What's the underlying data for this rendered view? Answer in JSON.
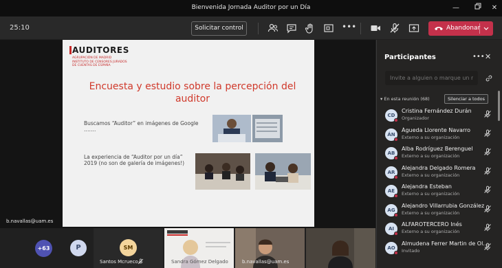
{
  "window": {
    "title": "Bienvenida Jornada Auditor por un Día"
  },
  "toolbar": {
    "timer": "25:10",
    "control_label": "Solicitar control",
    "leave_label": "Abandonar",
    "icons": [
      "participants-icon",
      "chat-icon",
      "raise-hand-icon",
      "share-tray-icon",
      "more-icon",
      "camera-icon",
      "mic-off-icon",
      "share-screen-icon"
    ],
    "leave_color": "#c4314b"
  },
  "slide": {
    "logo": "AUDITORES",
    "logo_sub": [
      "AGRUPACIÓN DE MADRID",
      "INSTITUTO DE CENSORES JURADOS",
      "DE CUENTAS DE ESPAÑA"
    ],
    "title": "Encuesta y estudio sobre la percepción del auditor",
    "line1": "Buscamos “Auditor” en imágenes de Google …….",
    "line2a": "La experiencia de “Auditor por un día”",
    "line2b": "2019  (no son de galería de imágenes!)"
  },
  "stage": {
    "presenter_name": "b.navallas@uam.es"
  },
  "strip": {
    "overflow_count": "+63",
    "p_initial": "P",
    "sm_initials": "SM",
    "sm_name": "Santos Mcrueco",
    "t4_name": "Sandra Gómez Delgado",
    "t5_name": "b.navallas@uam.es"
  },
  "panel": {
    "title": "Participantes",
    "invite_placeholder": "Invite a alguien o marque un núm",
    "section_label": "En esta reunión (68)",
    "mute_all_label": "Silenciar a todos",
    "participants": [
      {
        "initials": "CD",
        "name": "Cristina Fernández Durán",
        "sub": "Organizador"
      },
      {
        "initials": "ÁN",
        "name": "Águeda Llorente Navarro",
        "sub": "Externo a su organización"
      },
      {
        "initials": "AB",
        "name": "Alba Rodríguez Berenguel",
        "sub": "Externo a su organización"
      },
      {
        "initials": "AR",
        "name": "Alejandra Delgado Romera",
        "sub": "Externo a su organización"
      },
      {
        "initials": "AE",
        "name": "Alejandra Esteban",
        "sub": "Externo a su organización"
      },
      {
        "initials": "AG",
        "name": "Alejandro Villarrubia González",
        "sub": "Externo a su organización"
      },
      {
        "initials": "AI",
        "name": "ALFAROTERCERO Inés",
        "sub": "Externo a su organización"
      },
      {
        "initials": "AO",
        "name": "Almudena Ferrer Martin de Ol...",
        "sub": "Invitado"
      }
    ]
  }
}
